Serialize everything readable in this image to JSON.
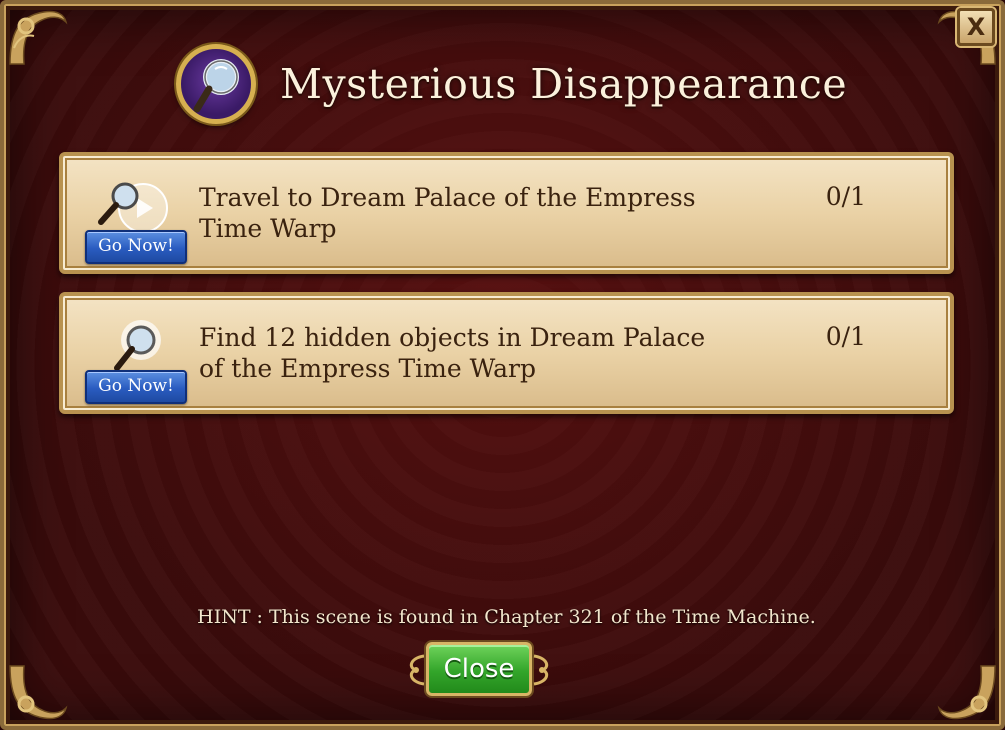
{
  "dialog": {
    "title": "Mysterious Disappearance",
    "close_x_label": "X"
  },
  "tasks": [
    {
      "description": "Travel to Dream Palace of the Empress Time Warp",
      "progress": "0/1",
      "button_label": "Go Now!",
      "icon": "magnifier-play-icon"
    },
    {
      "description": "Find 12 hidden objects in Dream Palace of the Empress Time Warp",
      "progress": "0/1",
      "button_label": "Go Now!",
      "icon": "magnifier-glow-icon"
    }
  ],
  "hint": "HINT : This scene is found in Chapter 321 of the Time Machine.",
  "footer": {
    "close_label": "Close"
  },
  "colors": {
    "background": "#3a0b0b",
    "panel": "#ead2a6",
    "go_button": "#2a5cc0",
    "close_button": "#33a52a",
    "gold_trim": "#c9a25d"
  }
}
